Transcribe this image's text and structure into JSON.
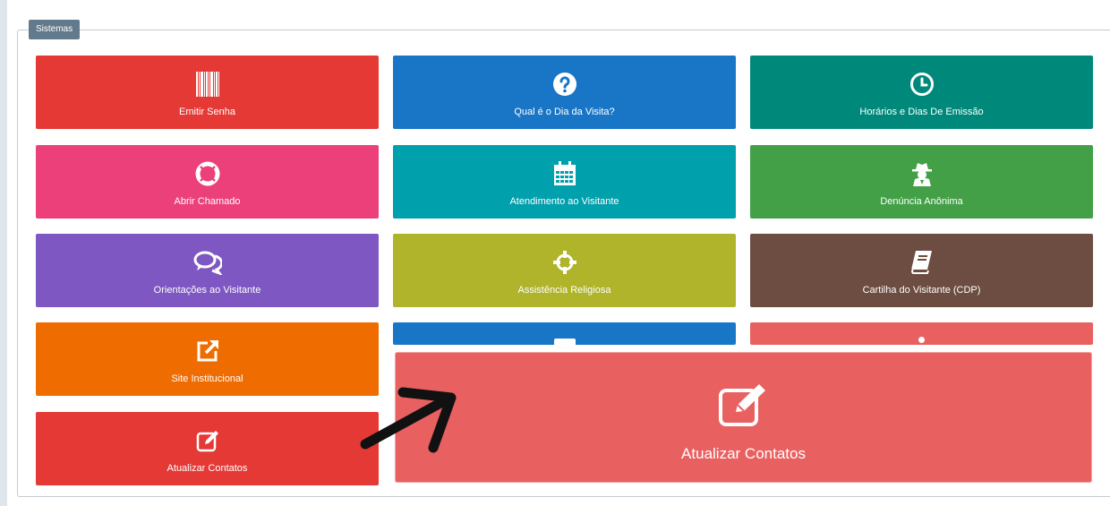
{
  "section": {
    "legend": "Sistemas"
  },
  "colors": {
    "red": "#e53935",
    "blue": "#1976c6",
    "teal_dark": "#00897b",
    "pink": "#ec407a",
    "cyan": "#00a0ad",
    "green": "#43a047",
    "purple": "#7e57c2",
    "olive": "#afb42b",
    "brown": "#6d4c41",
    "orange": "#ef6c00",
    "coral": "#e96060"
  },
  "tiles": [
    {
      "label": "Emitir Senha",
      "icon": "barcode-icon"
    },
    {
      "label": "Qual é o Dia da Visita?",
      "icon": "question-circle-icon"
    },
    {
      "label": "Horários e Dias De Emissão",
      "icon": "clock-icon"
    },
    {
      "label": "Abrir Chamado",
      "icon": "life-ring-icon"
    },
    {
      "label": "Atendimento ao Visitante",
      "icon": "calendar-icon"
    },
    {
      "label": "Denúncia Anônima",
      "icon": "user-secret-icon"
    },
    {
      "label": "Orientações ao Visitante",
      "icon": "comments-icon"
    },
    {
      "label": "Assistência Religiosa",
      "icon": "crosshairs-icon"
    },
    {
      "label": "Cartilha do Visitante (CDP)",
      "icon": "book-icon"
    },
    {
      "label": "Site Institucional",
      "icon": "external-link-icon"
    },
    {
      "label": "Atualizar Contatos",
      "icon": "edit-icon"
    }
  ],
  "zoomed": {
    "label": "Atualizar Contatos",
    "icon": "edit-icon"
  }
}
